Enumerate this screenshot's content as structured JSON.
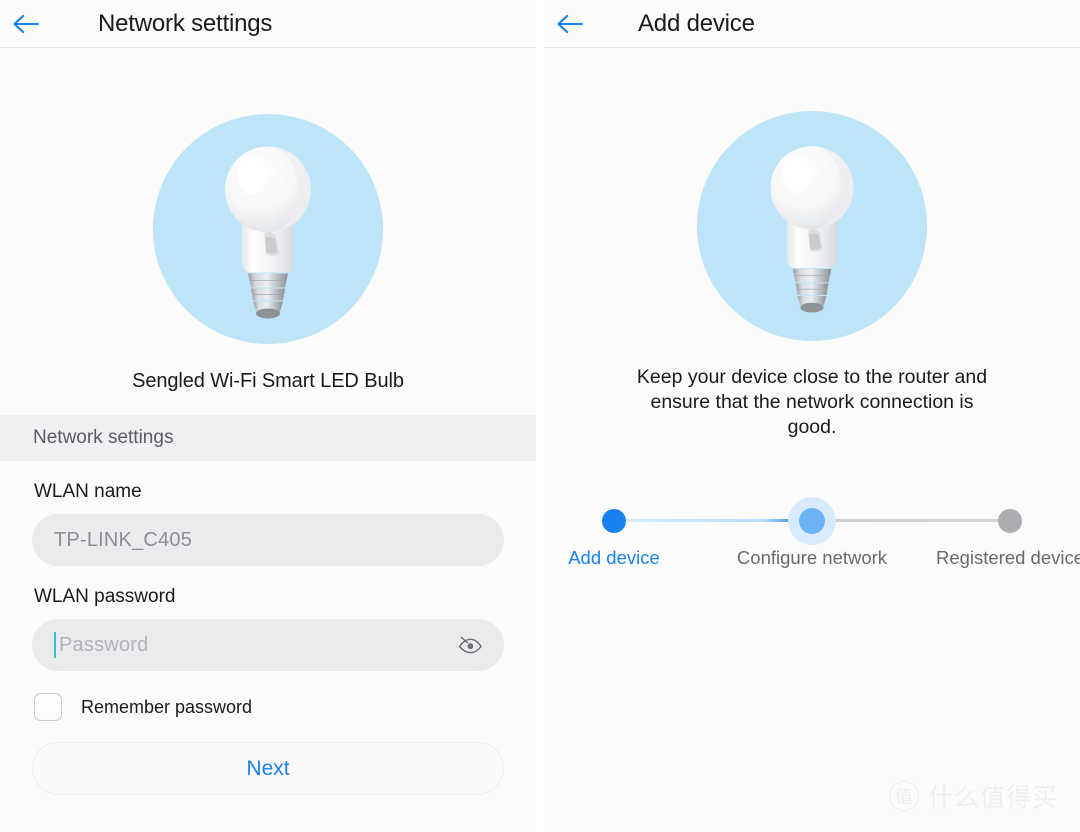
{
  "left_panel": {
    "appbar": {
      "back_icon": "arrow-left-icon",
      "title": "Network settings"
    },
    "hero": {
      "image": "smart-led-bulb-illustration",
      "circle_color": "#bde5f7",
      "caption": "Sengled Wi-Fi Smart LED Bulb"
    },
    "section": {
      "label": "Network settings"
    },
    "form": {
      "wlan_name": {
        "label": "WLAN name",
        "value": "TP-LINK_C405"
      },
      "wlan_password": {
        "label": "WLAN password",
        "value": "",
        "placeholder": "Password",
        "toggle_icon": "eye-off-icon"
      },
      "remember": {
        "label": "Remember password",
        "checked": false
      },
      "submit": {
        "label": "Next",
        "color": "#1a82f0"
      }
    }
  },
  "right_panel": {
    "appbar": {
      "back_icon": "arrow-left-icon",
      "title": "Add device"
    },
    "hero": {
      "image": "smart-led-bulb-illustration",
      "circle_color": "#bde5f7"
    },
    "instruction": "Keep your device close to the router and ensure that the network connection is good.",
    "stepper": {
      "steps": [
        {
          "label": "Add device",
          "state": "done"
        },
        {
          "label": "Configure network",
          "state": "current"
        },
        {
          "label": "Registered device",
          "state": "pending"
        }
      ],
      "active_color": "#1a82f0",
      "current_color": "#6cb3f6",
      "pending_color": "#adadb1"
    },
    "watermark": {
      "badge": "值",
      "text": "什么值得买"
    }
  }
}
